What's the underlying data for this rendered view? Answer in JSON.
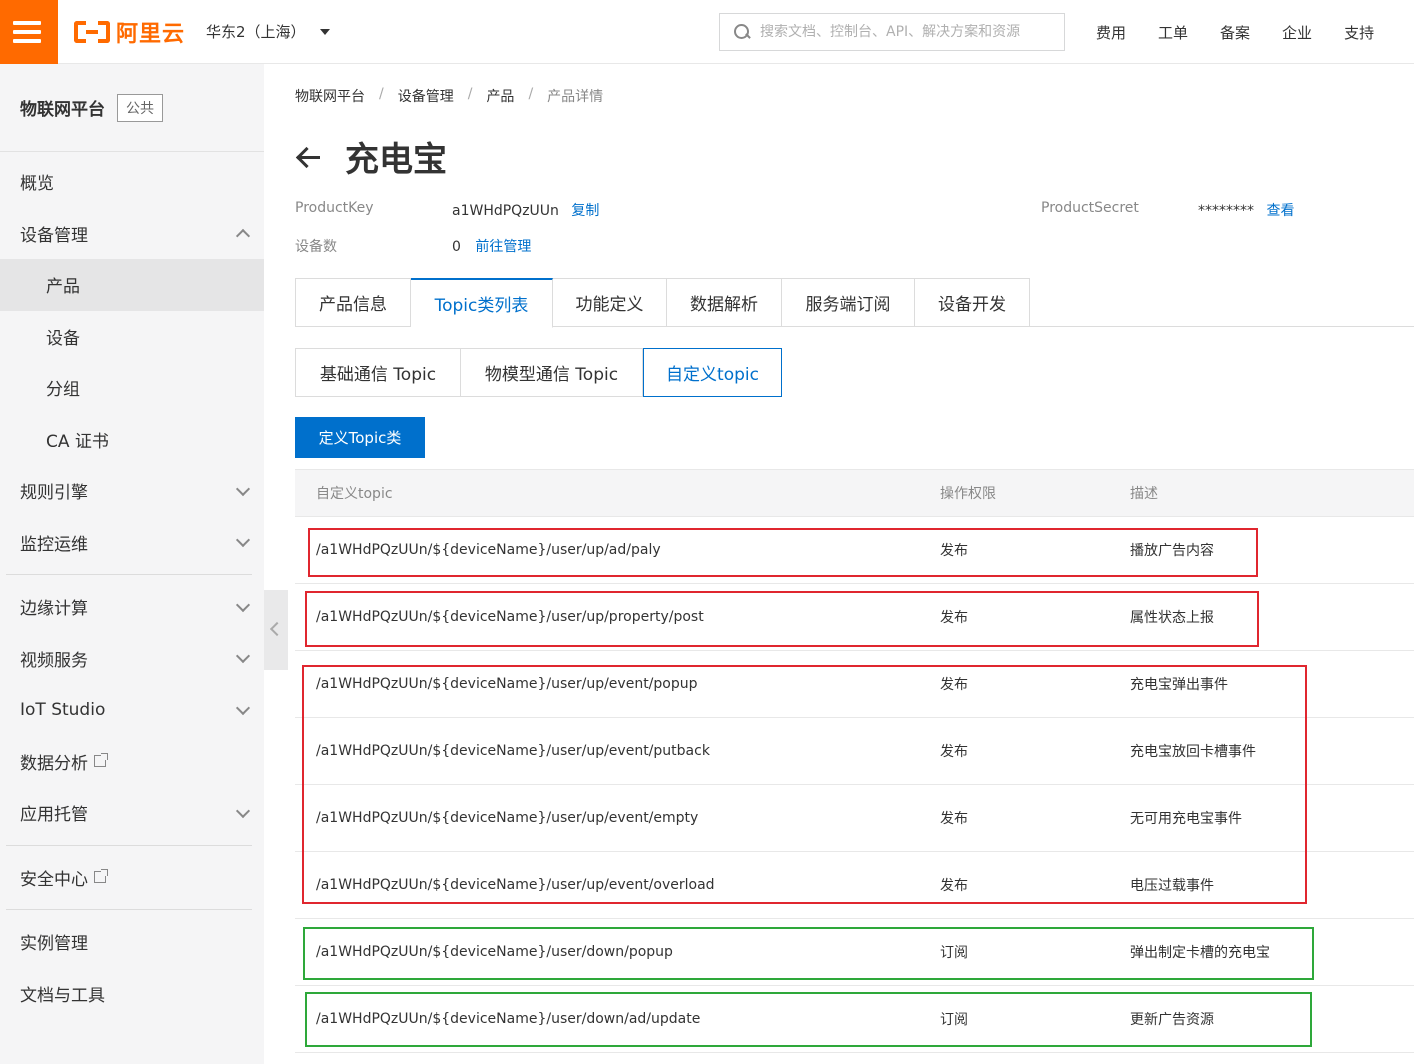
{
  "header": {
    "logo_text": "阿里云",
    "region": "华东2（上海）",
    "search_placeholder": "搜索文档、控制台、API、解决方案和资源",
    "nav": [
      "费用",
      "工单",
      "备案",
      "企业",
      "支持"
    ]
  },
  "sidebar": {
    "title": "物联网平台",
    "badge": "公共",
    "items": [
      {
        "label": "概览"
      },
      {
        "label": "设备管理"
      },
      {
        "label": "产品"
      },
      {
        "label": "设备"
      },
      {
        "label": "分组"
      },
      {
        "label": "CA 证书"
      },
      {
        "label": "规则引擎"
      },
      {
        "label": "监控运维"
      },
      {
        "label": "边缘计算"
      },
      {
        "label": "视频服务"
      },
      {
        "label": "IoT Studio"
      },
      {
        "label": "数据分析"
      },
      {
        "label": "应用托管"
      },
      {
        "label": "安全中心"
      },
      {
        "label": "实例管理"
      },
      {
        "label": "文档与工具"
      }
    ]
  },
  "breadcrumb": [
    "物联网平台",
    "设备管理",
    "产品",
    "产品详情"
  ],
  "page_title": "充电宝",
  "product": {
    "key_label": "ProductKey",
    "key_value": "a1WHdPQzUUn",
    "copy_label": "复制",
    "secret_label": "ProductSecret",
    "secret_value": "********",
    "view_label": "查看",
    "device_count_label": "设备数",
    "device_count": "0",
    "manage_label": "前往管理"
  },
  "tabs": [
    "产品信息",
    "Topic类列表",
    "功能定义",
    "数据解析",
    "服务端订阅",
    "设备开发"
  ],
  "subtabs": [
    "基础通信 Topic",
    "物模型通信 Topic",
    "自定义topic"
  ],
  "define_button": "定义Topic类",
  "table": {
    "headers": [
      "自定义topic",
      "操作权限",
      "描述"
    ],
    "rows": [
      {
        "topic": "/a1WHdPQzUUn/${deviceName}/user/up/ad/paly",
        "permission": "发布",
        "desc": "播放广告内容"
      },
      {
        "topic": "/a1WHdPQzUUn/${deviceName}/user/up/property/post",
        "permission": "发布",
        "desc": "属性状态上报"
      },
      {
        "topic": "/a1WHdPQzUUn/${deviceName}/user/up/event/popup",
        "permission": "发布",
        "desc": "充电宝弹出事件"
      },
      {
        "topic": "/a1WHdPQzUUn/${deviceName}/user/up/event/putback",
        "permission": "发布",
        "desc": "充电宝放回卡槽事件"
      },
      {
        "topic": "/a1WHdPQzUUn/${deviceName}/user/up/event/empty",
        "permission": "发布",
        "desc": "无可用充电宝事件"
      },
      {
        "topic": "/a1WHdPQzUUn/${deviceName}/user/up/event/overload",
        "permission": "发布",
        "desc": "电压过载事件"
      },
      {
        "topic": "/a1WHdPQzUUn/${deviceName}/user/down/popup",
        "permission": "订阅",
        "desc": "弹出制定卡槽的充电宝"
      },
      {
        "topic": "/a1WHdPQzUUn/${deviceName}/user/down/ad/update",
        "permission": "订阅",
        "desc": "更新广告资源"
      }
    ]
  },
  "colors": {
    "brand": "#ff6a00",
    "link": "#0070cc",
    "highlight_red": "#e0262f",
    "highlight_green": "#2ea83a"
  }
}
